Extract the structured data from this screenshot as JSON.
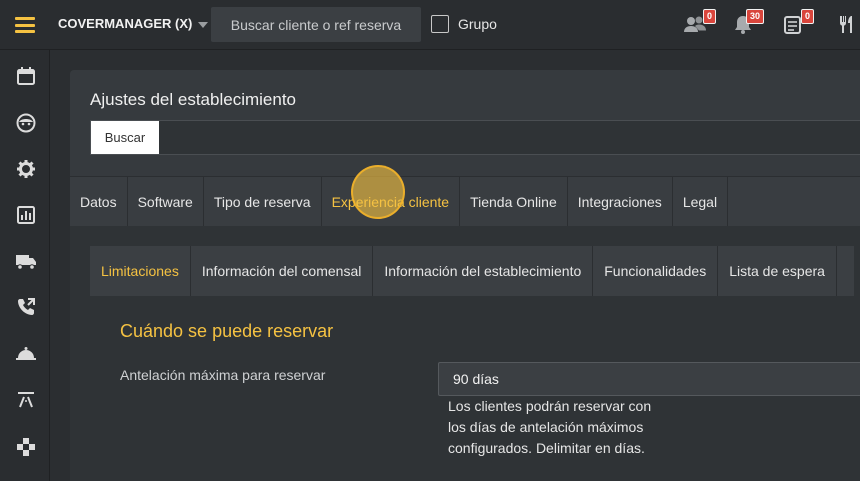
{
  "topbar": {
    "brand": "COVERMANAGER (X)",
    "search_placeholder": "Buscar cliente o ref reserva",
    "grupo_label": "Grupo",
    "badges": {
      "users": "0",
      "bell": "30",
      "notes": "0"
    }
  },
  "sidebar": {
    "items": [
      "calendar-icon",
      "face-icon",
      "gear-icon",
      "chart-icon",
      "truck-icon",
      "phone-icon",
      "cloche-icon",
      "road-icon",
      "puzzle-icon"
    ]
  },
  "panel": {
    "title": "Ajustes del establecimiento",
    "search_button": "Buscar",
    "tabs": [
      "Datos",
      "Software",
      "Tipo de reserva",
      "Experiencia cliente",
      "Tienda Online",
      "Integraciones",
      "Legal"
    ],
    "active_tab": "Experiencia cliente",
    "subtabs": [
      "Limitaciones",
      "Información del comensal",
      "Información del establecimiento",
      "Funcionalidades",
      "Lista de espera"
    ],
    "active_subtab": "Limitaciones"
  },
  "section": {
    "title": "Cuándo se puede reservar",
    "field_label": "Antelación máxima para reservar",
    "field_value": "90 días",
    "help": "Los clientes podrán reservar con los días de antelación máximos configurados. Delimitar en días."
  },
  "colors": {
    "accent": "#f5c242",
    "background": "#2b2e31",
    "badge": "#d9453c"
  }
}
